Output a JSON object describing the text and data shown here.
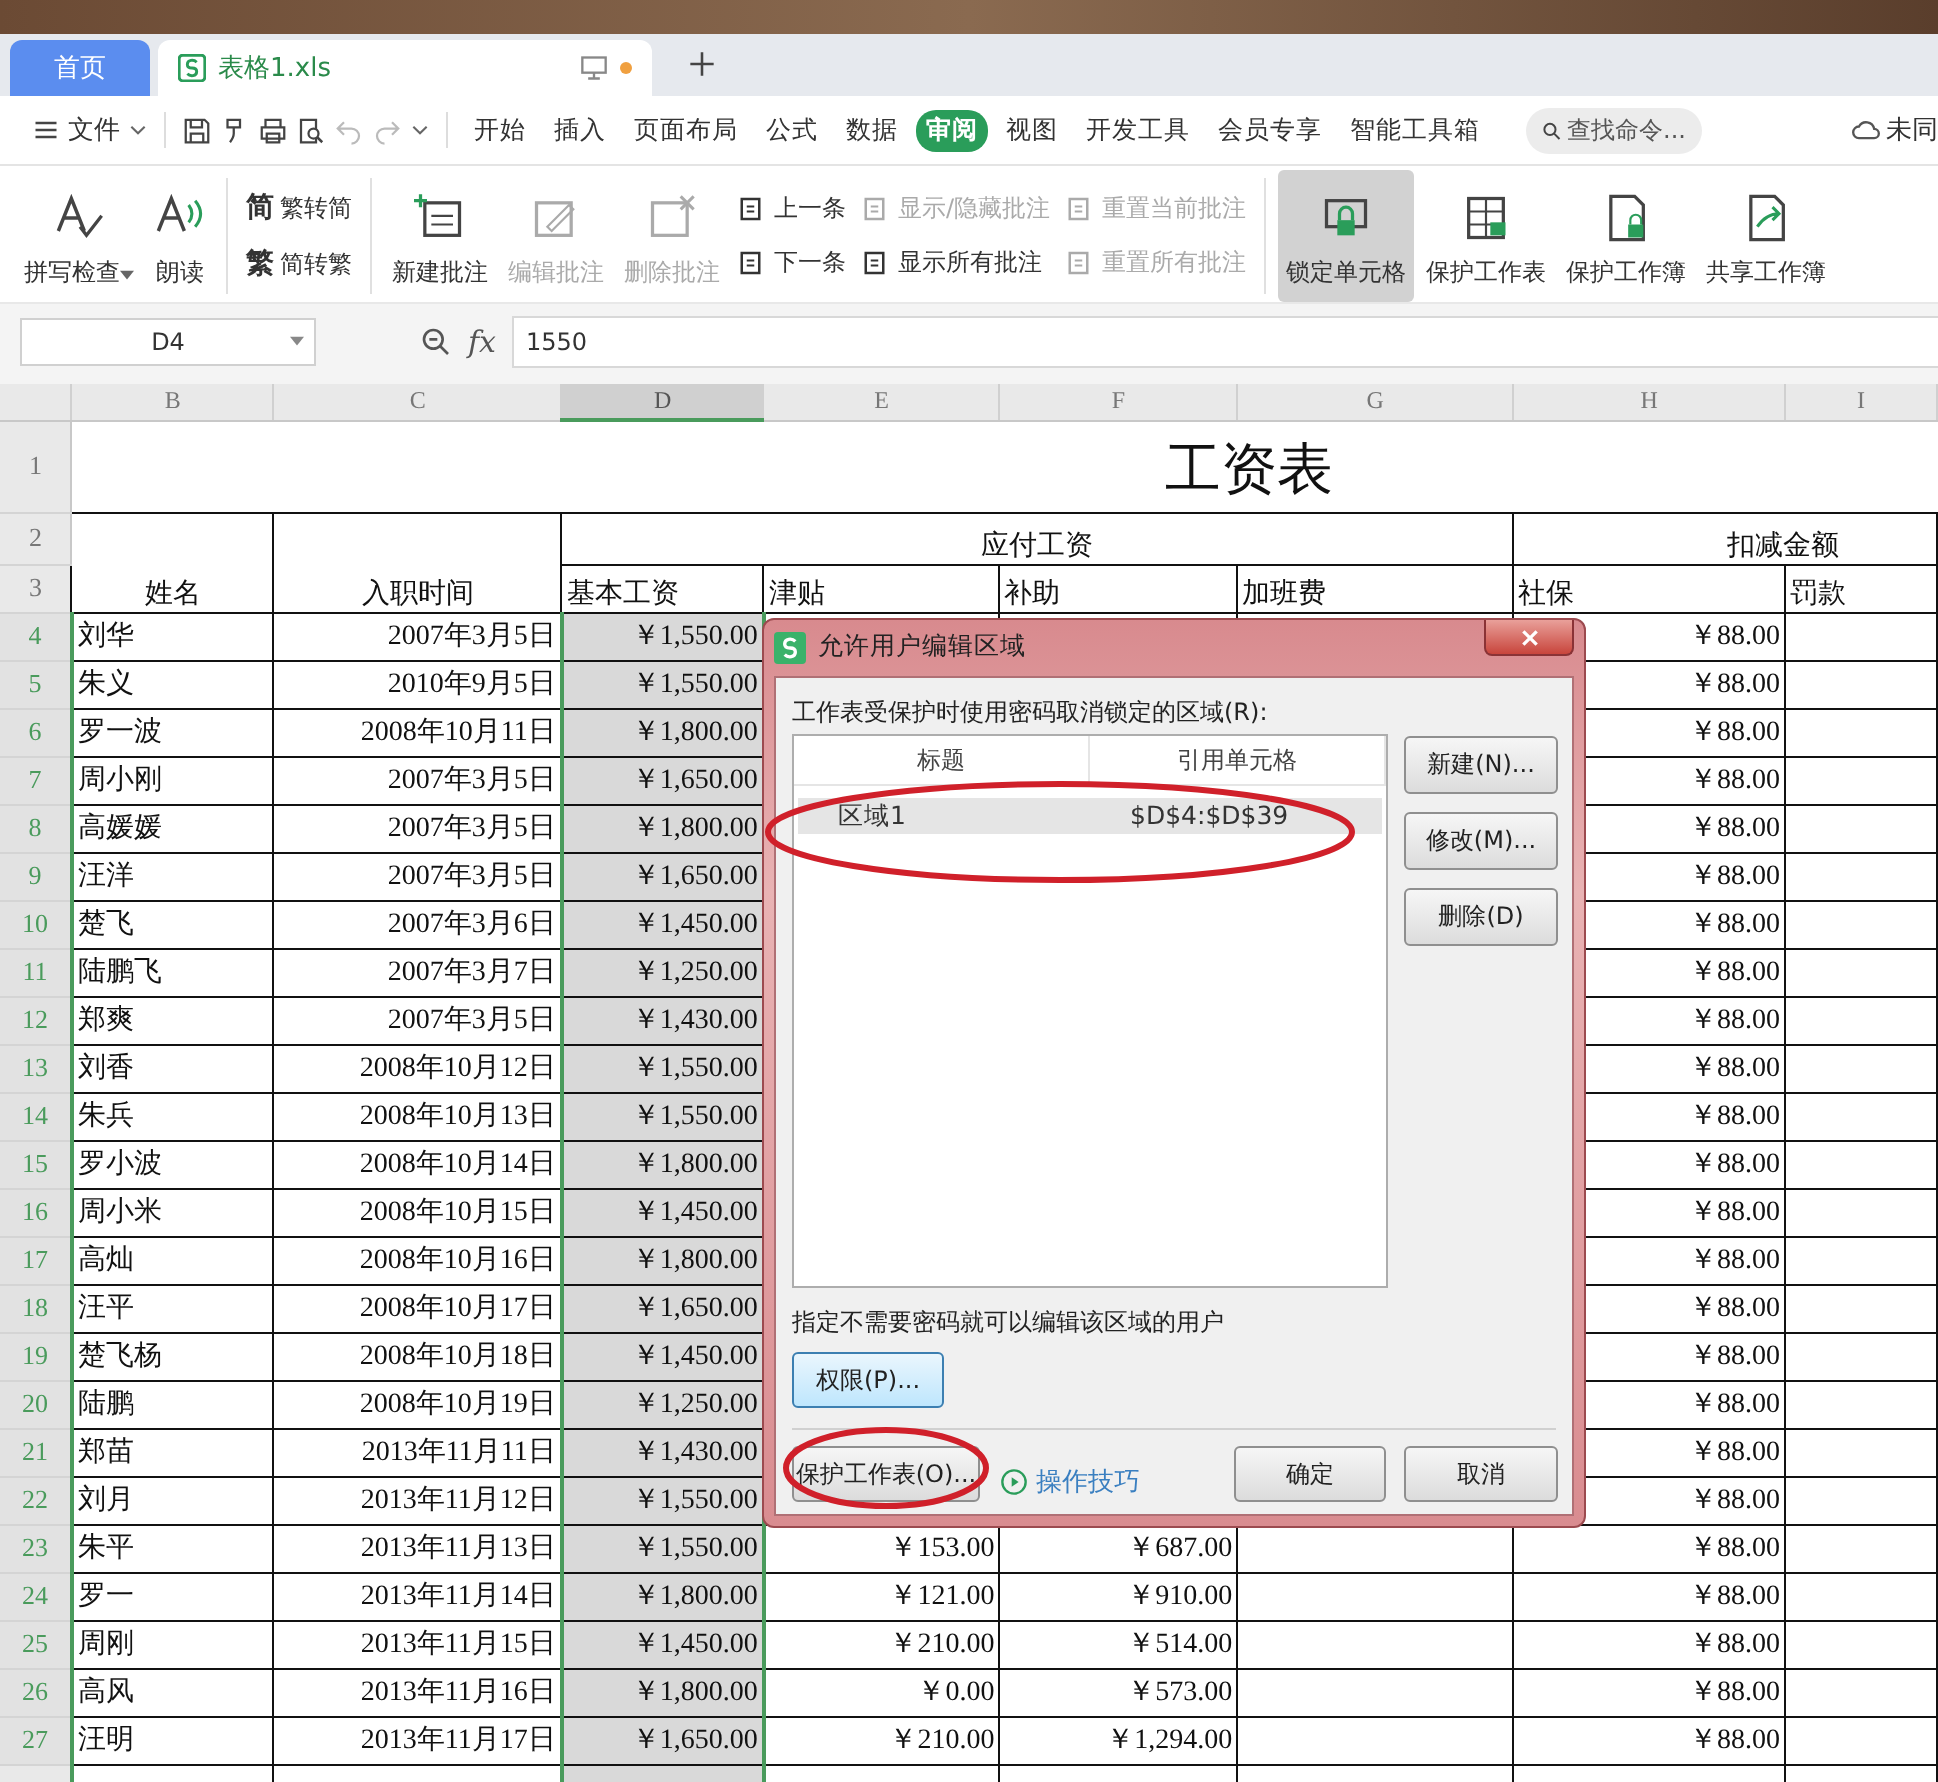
{
  "tabs": [
    {
      "label": "首页",
      "kind": "home",
      "selected": false,
      "modified": false
    },
    {
      "label": "表格1.xls",
      "kind": "document",
      "selected": true,
      "modified": true
    }
  ],
  "menu": {
    "file": "文件",
    "tabs": [
      {
        "label": "开始",
        "selected": false
      },
      {
        "label": "插入",
        "selected": false
      },
      {
        "label": "页面布局",
        "selected": false
      },
      {
        "label": "公式",
        "selected": false
      },
      {
        "label": "数据",
        "selected": false
      },
      {
        "label": "审阅",
        "selected": true
      },
      {
        "label": "视图",
        "selected": false
      },
      {
        "label": "开发工具",
        "selected": false
      },
      {
        "label": "会员专享",
        "selected": false
      },
      {
        "label": "智能工具箱",
        "selected": false
      }
    ],
    "search": {
      "placeholder": "查找命令..."
    },
    "account": "未同"
  },
  "ribbon": [
    {
      "kind": "large",
      "label": "拼写检查",
      "dropdown": true,
      "disabled": false,
      "pressed": false
    },
    {
      "kind": "large",
      "label": "朗读",
      "dropdown": false,
      "disabled": false,
      "pressed": false
    },
    {
      "kind": "separator"
    },
    {
      "kind": "stack",
      "items": [
        {
          "glyph": "简",
          "label": "繁转简",
          "disabled": false
        },
        {
          "glyph": "繁",
          "label": "简转繁",
          "disabled": false
        }
      ]
    },
    {
      "kind": "separator"
    },
    {
      "kind": "large",
      "label": "新建批注",
      "dropdown": false,
      "disabled": false,
      "pressed": false
    },
    {
      "kind": "large",
      "label": "编辑批注",
      "dropdown": false,
      "disabled": true,
      "pressed": false
    },
    {
      "kind": "large",
      "label": "删除批注",
      "dropdown": false,
      "disabled": true,
      "pressed": false
    },
    {
      "kind": "stack",
      "items": [
        {
          "label": "上一条",
          "disabled": false
        },
        {
          "label": "下一条",
          "disabled": false
        }
      ]
    },
    {
      "kind": "stack",
      "items": [
        {
          "label": "显示/隐藏批注",
          "disabled": true
        },
        {
          "label": "显示所有批注",
          "disabled": false
        }
      ]
    },
    {
      "kind": "stack",
      "items": [
        {
          "label": "重置当前批注",
          "disabled": true
        },
        {
          "label": "重置所有批注",
          "disabled": true
        }
      ]
    },
    {
      "kind": "separator"
    },
    {
      "kind": "large",
      "label": "锁定单元格",
      "dropdown": false,
      "disabled": false,
      "pressed": true
    },
    {
      "kind": "large",
      "label": "保护工作表",
      "dropdown": false,
      "disabled": false,
      "pressed": false
    },
    {
      "kind": "large",
      "label": "保护工作簿",
      "dropdown": false,
      "disabled": false,
      "pressed": false
    },
    {
      "kind": "large",
      "label": "共享工作簿",
      "dropdown": false,
      "disabled": false,
      "pressed": false
    }
  ],
  "formula_bar": {
    "cell": "D4",
    "function_label": "fx",
    "value": "1550"
  },
  "sheet": {
    "columns": [
      {
        "label": "B",
        "selected": false
      },
      {
        "label": "C",
        "selected": false
      },
      {
        "label": "D",
        "selected": true
      },
      {
        "label": "E",
        "selected": false
      },
      {
        "label": "F",
        "selected": false
      },
      {
        "label": "G",
        "selected": false
      },
      {
        "label": "H",
        "selected": false
      },
      {
        "label": "I",
        "selected": false
      }
    ],
    "title": "工资表",
    "group_headers": [
      "应付工资",
      "扣减金额"
    ],
    "headers": [
      "姓名",
      "入职时间",
      "基本工资",
      "津贴",
      "补助",
      "加班费",
      "社保",
      "罚款"
    ],
    "header_rows": [
      {
        "num": "1",
        "selected": false
      },
      {
        "num": "2",
        "selected": false
      },
      {
        "num": "3",
        "selected": false
      }
    ],
    "rows": [
      {
        "num": "4",
        "selected": true,
        "name": "刘华",
        "date": "2007年3月5日",
        "basic": "￥1,550.00",
        "social": "￥88.00"
      },
      {
        "num": "5",
        "selected": true,
        "name": "朱义",
        "date": "2010年9月5日",
        "basic": "￥1,550.00",
        "social": "￥88.00"
      },
      {
        "num": "6",
        "selected": true,
        "name": "罗一波",
        "date": "2008年10月11日",
        "basic": "￥1,800.00",
        "social": "￥88.00"
      },
      {
        "num": "7",
        "selected": true,
        "name": "周小刚",
        "date": "2007年3月5日",
        "basic": "￥1,650.00",
        "social": "￥88.00"
      },
      {
        "num": "8",
        "selected": true,
        "name": "高媛媛",
        "date": "2007年3月5日",
        "basic": "￥1,800.00",
        "social": "￥88.00"
      },
      {
        "num": "9",
        "selected": true,
        "name": "汪洋",
        "date": "2007年3月5日",
        "basic": "￥1,650.00",
        "social": "￥88.00"
      },
      {
        "num": "10",
        "selected": true,
        "name": "楚飞",
        "date": "2007年3月6日",
        "basic": "￥1,450.00",
        "social": "￥88.00"
      },
      {
        "num": "11",
        "selected": true,
        "name": "陆鹏飞",
        "date": "2007年3月7日",
        "basic": "￥1,250.00",
        "social": "￥88.00"
      },
      {
        "num": "12",
        "selected": true,
        "name": "郑爽",
        "date": "2007年3月5日",
        "basic": "￥1,430.00",
        "social": "￥88.00"
      },
      {
        "num": "13",
        "selected": true,
        "name": "刘香",
        "date": "2008年10月12日",
        "basic": "￥1,550.00",
        "social": "￥88.00"
      },
      {
        "num": "14",
        "selected": true,
        "name": "朱兵",
        "date": "2008年10月13日",
        "basic": "￥1,550.00",
        "social": "￥88.00"
      },
      {
        "num": "15",
        "selected": true,
        "name": "罗小波",
        "date": "2008年10月14日",
        "basic": "￥1,800.00",
        "social": "￥88.00"
      },
      {
        "num": "16",
        "selected": true,
        "name": "周小米",
        "date": "2008年10月15日",
        "basic": "￥1,450.00",
        "social": "￥88.00"
      },
      {
        "num": "17",
        "selected": true,
        "name": "高灿",
        "date": "2008年10月16日",
        "basic": "￥1,800.00",
        "social": "￥88.00"
      },
      {
        "num": "18",
        "selected": true,
        "name": "汪平",
        "date": "2008年10月17日",
        "basic": "￥1,650.00",
        "social": "￥88.00"
      },
      {
        "num": "19",
        "selected": true,
        "name": "楚飞杨",
        "date": "2008年10月18日",
        "basic": "￥1,450.00",
        "social": "￥88.00"
      },
      {
        "num": "20",
        "selected": true,
        "name": "陆鹏",
        "date": "2008年10月19日",
        "basic": "￥1,250.00",
        "social": "￥88.00"
      },
      {
        "num": "21",
        "selected": true,
        "name": "郑苗",
        "date": "2013年11月11日",
        "basic": "￥1,430.00",
        "social": "￥88.00"
      },
      {
        "num": "22",
        "selected": true,
        "name": "刘月",
        "date": "2013年11月12日",
        "basic": "￥1,550.00",
        "social": "￥88.00"
      },
      {
        "num": "23",
        "selected": true,
        "name": "朱平",
        "date": "2013年11月13日",
        "basic": "￥1,550.00",
        "allowance": "￥153.00",
        "subsidy": "￥687.00",
        "social": "￥88.00"
      },
      {
        "num": "24",
        "selected": true,
        "name": "罗一",
        "date": "2013年11月14日",
        "basic": "￥1,800.00",
        "allowance": "￥121.00",
        "subsidy": "￥910.00",
        "social": "￥88.00"
      },
      {
        "num": "25",
        "selected": true,
        "name": "周刚",
        "date": "2013年11月15日",
        "basic": "￥1,450.00",
        "allowance": "￥210.00",
        "subsidy": "￥514.00",
        "social": "￥88.00"
      },
      {
        "num": "26",
        "selected": true,
        "name": "高风",
        "date": "2013年11月16日",
        "basic": "￥1,800.00",
        "allowance": "￥0.00",
        "subsidy": "￥573.00",
        "social": "￥88.00"
      },
      {
        "num": "27",
        "selected": true,
        "name": "汪明",
        "date": "2013年11月17日",
        "basic": "￥1,650.00",
        "allowance": "￥210.00",
        "subsidy": "￥1,294.00",
        "social": "￥88.00"
      }
    ]
  },
  "dialog": {
    "title": "允许用户编辑区域",
    "ranges_label": "工作表受保护时使用密码取消锁定的区域(R):",
    "list_columns": [
      "标题",
      "引用单元格"
    ],
    "ranges": [
      {
        "title": "区域1",
        "ref": "$D$4:$D$39",
        "selected": true
      }
    ],
    "side_buttons": [
      "新建(N)...",
      "修改(M)...",
      "删除(D)"
    ],
    "users_label": "指定不需要密码就可以编辑该区域的用户",
    "permissions_button": "权限(P)...",
    "protect_button": "保护工作表(O)...",
    "tips_link": "操作技巧",
    "ok": "确定",
    "cancel": "取消"
  }
}
